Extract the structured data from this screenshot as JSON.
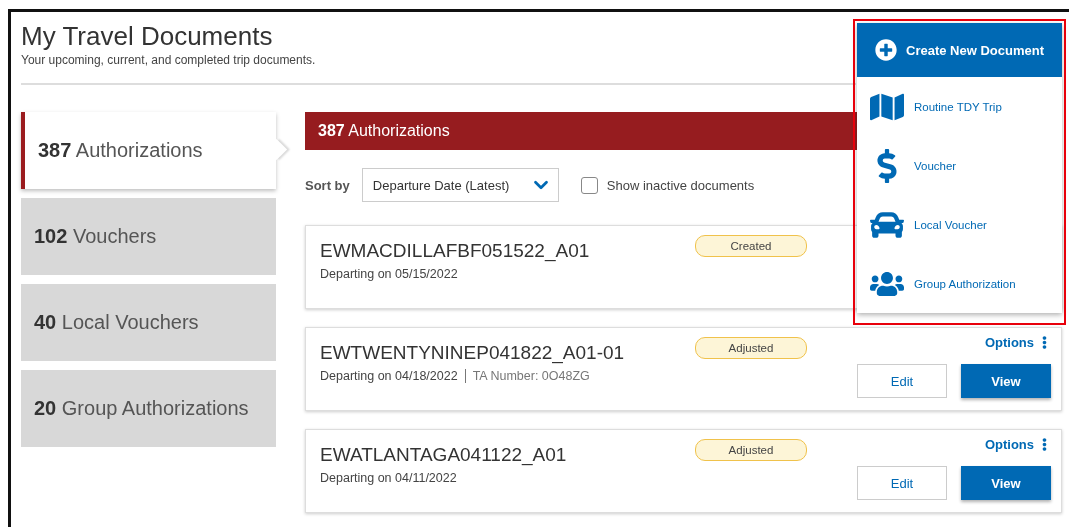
{
  "page": {
    "title": "My Travel Documents",
    "subtitle": "Your upcoming, current, and completed trip documents."
  },
  "tabs": [
    {
      "count": "387",
      "label": "Authorizations",
      "selected": true
    },
    {
      "count": "102",
      "label": "Vouchers",
      "selected": false
    },
    {
      "count": "40",
      "label": "Local Vouchers",
      "selected": false
    },
    {
      "count": "20",
      "label": "Group Authorizations",
      "selected": false
    }
  ],
  "list_header": {
    "count": "387",
    "label": "Authorizations"
  },
  "sort": {
    "label": "Sort by",
    "value": "Departure Date (Latest)"
  },
  "show_inactive": {
    "label": "Show inactive documents",
    "checked": false
  },
  "documents": [
    {
      "name": "EWMACDILLAFBF051522_A01",
      "departing": "Departing on 05/15/2022",
      "status": "Created"
    },
    {
      "name": "EWTWENTYNINEP041822_A01-01",
      "departing": "Departing on 04/18/2022",
      "ta_number": "TA Number: 0O48ZG",
      "status": "Adjusted",
      "options": "Options",
      "actions": [
        "Edit",
        "View"
      ]
    },
    {
      "name": "EWATLANTAGA041122_A01",
      "departing": "Departing on 04/11/2022",
      "status": "Adjusted",
      "options": "Options",
      "actions": [
        "Edit",
        "View"
      ]
    }
  ],
  "create_menu": {
    "button": "Create New Document",
    "highlighted": true,
    "items": [
      {
        "kind": "map",
        "label": "Routine TDY Trip"
      },
      {
        "kind": "dollar",
        "label": "Voucher"
      },
      {
        "kind": "car",
        "label": "Local Voucher"
      },
      {
        "kind": "group",
        "label": "Group Authorization"
      }
    ]
  }
}
